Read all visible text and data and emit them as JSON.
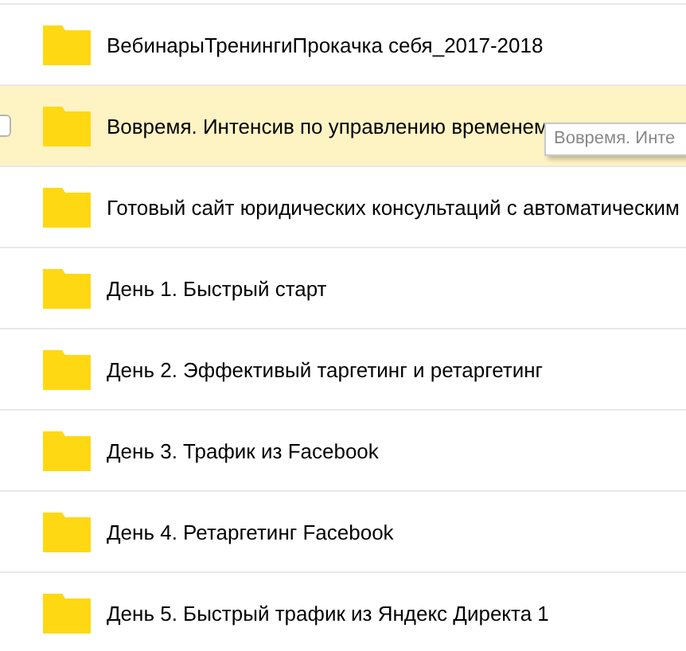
{
  "folders": [
    {
      "name": "ВебинарыТренингиПрокачка себя_2017-2018",
      "hovered": false
    },
    {
      "name": "Вовремя. Интенсив по управлению временем",
      "hovered": true,
      "checked": false
    },
    {
      "name": "Готовый сайт юридических консультаций с автоматическим",
      "hovered": false
    },
    {
      "name": "День 1. Быстрый старт",
      "hovered": false
    },
    {
      "name": "День 2. Эффективый таргетинг и ретаргетинг",
      "hovered": false
    },
    {
      "name": "День 3. Трафик из Facebook",
      "hovered": false
    },
    {
      "name": "День 4. Ретаргетинг Facebook",
      "hovered": false
    },
    {
      "name": "День 5. Быстрый трафик из Яндекс Директа 1",
      "hovered": false
    }
  ],
  "tooltip": {
    "text": "Вовремя. Инте"
  }
}
